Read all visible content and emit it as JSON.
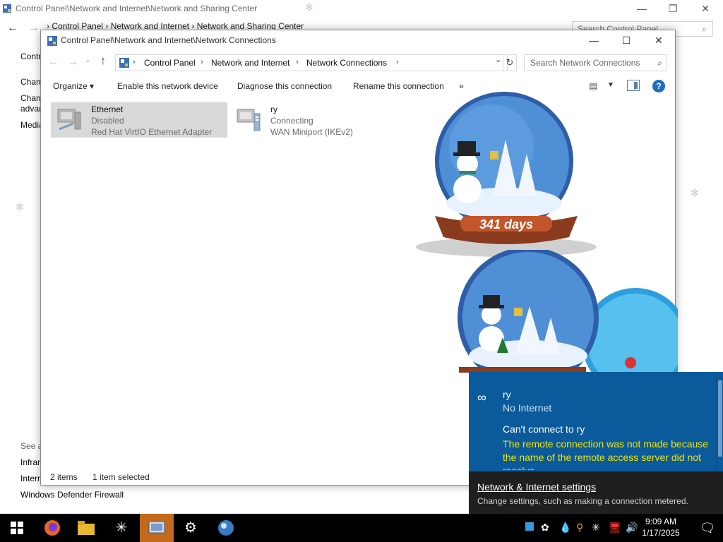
{
  "background_window": {
    "title": "Control Panel\\Network and Internet\\Network and Sharing Center",
    "address": "›  Control Panel  ›  Network and Internet  ›  Network and Sharing Center",
    "search_placeholder": "Search Control Panel",
    "sidebar": [
      "Control Panel Home",
      "Change adapter settings",
      "Change advanced sharing settings",
      "Media streaming options"
    ],
    "see_also": "See also",
    "links": [
      "Infrared",
      "Internet Options",
      "Windows Defender Firewall"
    ]
  },
  "window": {
    "title": "Control Panel\\Network and Internet\\Network Connections",
    "breadcrumbs": [
      "Control Panel",
      "Network and Internet",
      "Network Connections"
    ],
    "search_placeholder": "Search Network Connections"
  },
  "toolbar": {
    "organize": "Organize ▾",
    "enable": "Enable this network device",
    "diagnose": "Diagnose this connection",
    "rename": "Rename this connection",
    "more": "»"
  },
  "connections": [
    {
      "name": "Ethernet",
      "status": "Disabled",
      "device": "Red Hat VirtIO Ethernet Adapter"
    },
    {
      "name": "ry",
      "status": "Connecting",
      "device": "WAN Miniport (IKEv2)"
    }
  ],
  "statusbar": {
    "count": "2 items",
    "selected": "1 item selected"
  },
  "snowglobe": {
    "counter": "341 days"
  },
  "notification": {
    "network_name": "ry",
    "network_status": "No Internet",
    "message": "Can't connect to ry",
    "error": "The remote connection was not made because the name of the remote access server did not resolve.",
    "settings_link": "Network & Internet settings",
    "settings_desc": "Change settings, such as making a connection metered."
  },
  "taskbar": {
    "time": "9:09 AM",
    "date": "1/17/2025"
  },
  "colors": {
    "notification_bg": "#0a5a9c",
    "error_text": "#f2e600",
    "taskbar": "#000000",
    "active_app": "#c26a1a"
  }
}
